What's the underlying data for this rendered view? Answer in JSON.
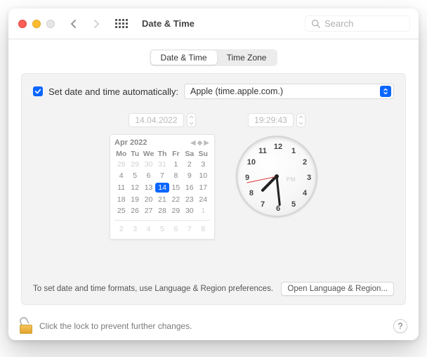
{
  "window": {
    "title": "Date & Time"
  },
  "search": {
    "placeholder": "Search"
  },
  "tabs": {
    "date_time": "Date & Time",
    "time_zone": "Time Zone",
    "active": "date_time"
  },
  "auto": {
    "checked": true,
    "label": "Set date and time automatically:",
    "server": "Apple (time.apple.com.)"
  },
  "date": {
    "field": "14.04.2022"
  },
  "time": {
    "field": "19:29:43",
    "pm_label": "PM"
  },
  "calendar": {
    "month_label": "Apr 2022",
    "weekday_headers": [
      "Mo",
      "Tu",
      "We",
      "Th",
      "Fr",
      "Sa",
      "Su"
    ],
    "rows": [
      [
        {
          "d": "28",
          "dim": true
        },
        {
          "d": "29",
          "dim": true
        },
        {
          "d": "30",
          "dim": true
        },
        {
          "d": "31",
          "dim": true
        },
        {
          "d": "1"
        },
        {
          "d": "2"
        },
        {
          "d": "3"
        }
      ],
      [
        {
          "d": "4"
        },
        {
          "d": "5"
        },
        {
          "d": "6"
        },
        {
          "d": "7"
        },
        {
          "d": "8"
        },
        {
          "d": "9"
        },
        {
          "d": "10"
        }
      ],
      [
        {
          "d": "11"
        },
        {
          "d": "12"
        },
        {
          "d": "13"
        },
        {
          "d": "14",
          "sel": true
        },
        {
          "d": "15"
        },
        {
          "d": "16"
        },
        {
          "d": "17"
        }
      ],
      [
        {
          "d": "18"
        },
        {
          "d": "19"
        },
        {
          "d": "20"
        },
        {
          "d": "21"
        },
        {
          "d": "22"
        },
        {
          "d": "23"
        },
        {
          "d": "24"
        }
      ],
      [
        {
          "d": "25"
        },
        {
          "d": "26"
        },
        {
          "d": "27"
        },
        {
          "d": "28"
        },
        {
          "d": "29"
        },
        {
          "d": "30"
        },
        {
          "d": "1",
          "dim": true
        }
      ],
      [
        {
          "d": "2",
          "dim": true
        },
        {
          "d": "3",
          "dim": true
        },
        {
          "d": "4",
          "dim": true
        },
        {
          "d": "5",
          "dim": true
        },
        {
          "d": "6",
          "dim": true
        },
        {
          "d": "7",
          "dim": true
        },
        {
          "d": "8",
          "dim": true
        }
      ]
    ]
  },
  "clock": {
    "numbers": [
      "12",
      "1",
      "2",
      "3",
      "4",
      "5",
      "6",
      "7",
      "8",
      "9",
      "10",
      "11"
    ],
    "hour": 19,
    "minute": 29,
    "second": 43
  },
  "info": {
    "text": "To set date and time formats, use Language & Region preferences.",
    "button": "Open Language & Region..."
  },
  "footer": {
    "lock_text": "Click the lock to prevent further changes.",
    "help": "?"
  }
}
